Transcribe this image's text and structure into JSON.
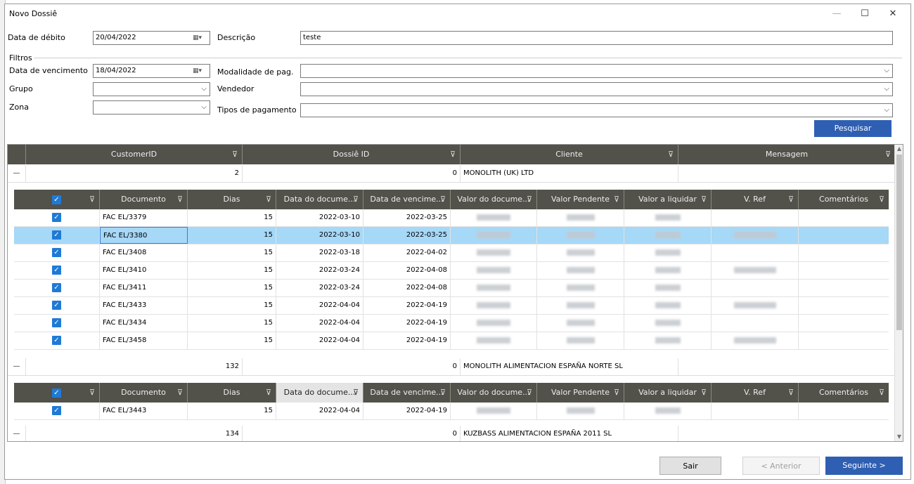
{
  "window": {
    "title": "Novo Dossiê",
    "min_glyph": "—",
    "max_glyph": "☐",
    "close_glyph": "✕"
  },
  "form": {
    "debit_date_label": "Data de débito",
    "debit_date": "20/04/2022",
    "description_label": "Descrição",
    "description": "teste",
    "filters_label": "Filtros",
    "due_date_label": "Data de vencimento",
    "due_date": "18/04/2022",
    "payment_mode_label": "Modalidade de pag.",
    "group_label": "Grupo",
    "seller_label": "Vendedor",
    "zone_label": "Zona",
    "payment_types_label": "Tipos de pagamento",
    "search_button": "Pesquisar",
    "dropdown_glyph": "⌵",
    "calendar_glyph": "▦▾"
  },
  "grid": {
    "columns": [
      "CustomerID",
      "Dossiê ID",
      "Cliente",
      "Mensagem"
    ],
    "filter_glyph": "⊽",
    "collapse_glyph": "—",
    "check_glyph": "✓",
    "sub_columns": [
      "Documento",
      "Dias",
      "Data do docume...",
      "Data de vencime...",
      "Valor do docume...",
      "Valor Pendente",
      "Valor a liquidar",
      "V. Ref",
      "Comentários"
    ],
    "groups": [
      {
        "customer_id": "2",
        "dossier_id": "0",
        "client": "MONOLITH (UK) LTD",
        "rows": [
          {
            "doc": "FAC EL/3379",
            "days": "15",
            "doc_date": "2022-03-10",
            "due_date": "2022-03-25"
          },
          {
            "doc": "FAC EL/3380",
            "days": "15",
            "doc_date": "2022-03-10",
            "due_date": "2022-03-25"
          },
          {
            "doc": "FAC EL/3408",
            "days": "15",
            "doc_date": "2022-03-18",
            "due_date": "2022-04-02"
          },
          {
            "doc": "FAC EL/3410",
            "days": "15",
            "doc_date": "2022-03-24",
            "due_date": "2022-04-08"
          },
          {
            "doc": "FAC EL/3411",
            "days": "15",
            "doc_date": "2022-03-24",
            "due_date": "2022-04-08"
          },
          {
            "doc": "FAC EL/3433",
            "days": "15",
            "doc_date": "2022-04-04",
            "due_date": "2022-04-19"
          },
          {
            "doc": "FAC EL/3434",
            "days": "15",
            "doc_date": "2022-04-04",
            "due_date": "2022-04-19"
          },
          {
            "doc": "FAC EL/3458",
            "days": "15",
            "doc_date": "2022-04-04",
            "due_date": "2022-04-19"
          }
        ]
      },
      {
        "customer_id": "132",
        "dossier_id": "0",
        "client": "MONOLITH ALIMENTACION ESPAÑA NORTE SL",
        "rows": [
          {
            "doc": "FAC EL/3443",
            "days": "15",
            "doc_date": "2022-04-04",
            "due_date": "2022-04-19"
          }
        ]
      },
      {
        "customer_id": "134",
        "dossier_id": "0",
        "client": "KUZBASS ALIMENTACION ESPAÑA 2011 SL",
        "rows": []
      }
    ]
  },
  "footer": {
    "exit": "Sair",
    "prev": "< Anterior",
    "next": "Seguinte >"
  }
}
